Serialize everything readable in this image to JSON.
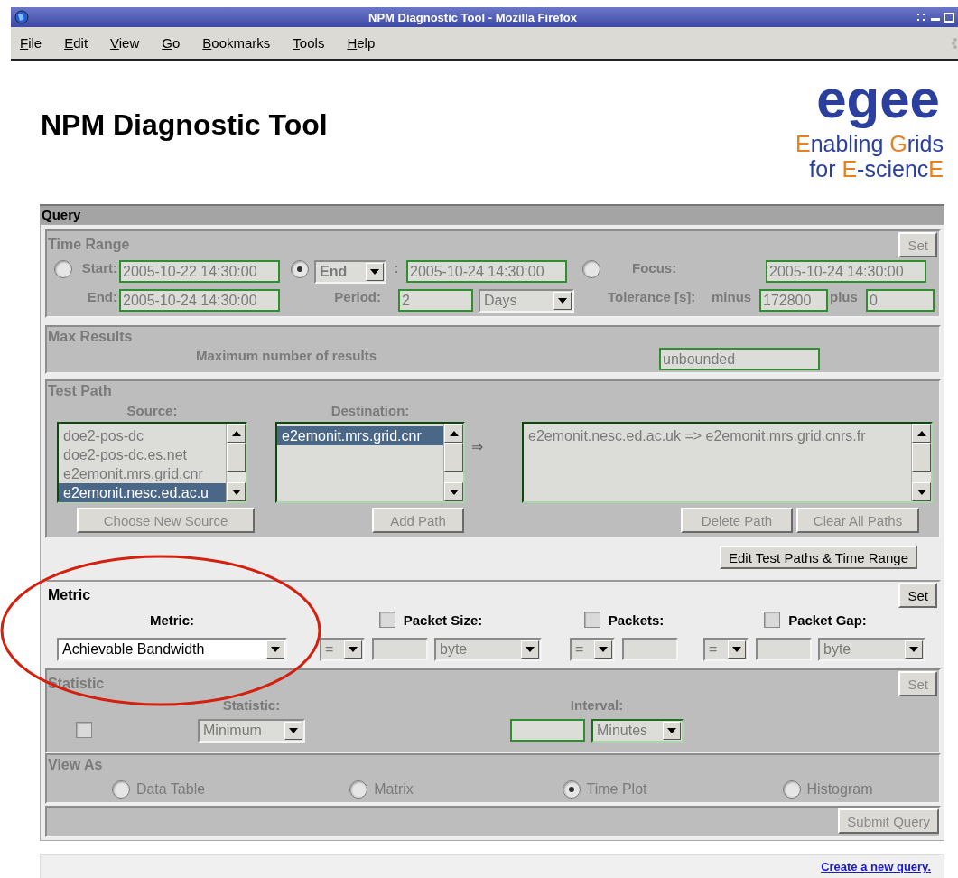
{
  "window": {
    "title": "NPM Diagnostic Tool - Mozilla Firefox"
  },
  "menu": [
    "File",
    "Edit",
    "View",
    "Go",
    "Bookmarks",
    "Tools",
    "Help"
  ],
  "heading": "NPM Diagnostic Tool",
  "logo": {
    "wordmark": "egee",
    "tagline": [
      "Enabling Grids",
      "for E-sciencE"
    ]
  },
  "query": {
    "title": "Query",
    "time_range": {
      "title": "Time Range",
      "disabled": true,
      "set_button": "Set",
      "start": {
        "selected": false,
        "label": "Start:",
        "value": "2005-10-22 14:30:00"
      },
      "end": {
        "label": "End:",
        "value": "2005-10-24 14:30:00"
      },
      "anchor": {
        "selected": true,
        "select": "End",
        "separator": ":",
        "value": "2005-10-24 14:30:00"
      },
      "period": {
        "label": "Period:",
        "value": "2",
        "unit": "Days"
      },
      "focus": {
        "selected": false,
        "label": "Focus:",
        "value": "2005-10-24 14:30:00"
      },
      "tolerance": {
        "label": "Tolerance [s]:",
        "minus_label": "minus",
        "minus_value": "172800",
        "plus_label": "plus",
        "plus_value": "0"
      }
    },
    "max_results": {
      "title": "Max Results",
      "disabled": true,
      "label": "Maximum number of results",
      "value": "unbounded"
    },
    "test_path": {
      "title": "Test Path",
      "disabled": true,
      "source_label": "Source:",
      "destination_label": "Destination:",
      "sources": [
        {
          "text": "doe2-pos-dc",
          "selected": false
        },
        {
          "text": "doe2-pos-dc.es.net",
          "selected": false
        },
        {
          "text": "e2emonit.mrs.grid.cnr",
          "selected": false
        },
        {
          "text": "e2emonit.nesc.ed.ac.u",
          "selected": true
        }
      ],
      "destinations": [
        {
          "text": "e2emonit.mrs.grid.cnr",
          "selected": true
        }
      ],
      "arrow": "⇒",
      "paths": [
        {
          "text": "e2emonit.nesc.ed.ac.uk => e2emonit.mrs.grid.cnrs.fr",
          "selected": false
        }
      ],
      "buttons": [
        "Choose New Source",
        "Add Path",
        "Delete Path",
        "Clear All Paths"
      ]
    },
    "edit_button": "Edit Test Paths & Time Range",
    "metric": {
      "title": "Metric",
      "disabled": false,
      "set_button": "Set",
      "label": "Metric:",
      "value": "Achievable Bandwidth",
      "filters": [
        {
          "label": "Packet Size:",
          "checked": false,
          "operator": "=",
          "unit": "byte"
        },
        {
          "label": "Packets:",
          "checked": false,
          "operator": "="
        },
        {
          "label": "Packet Gap:",
          "checked": false,
          "operator": "=",
          "unit": "byte"
        }
      ]
    },
    "statistic": {
      "title": "Statistic",
      "disabled": true,
      "set_button": "Set",
      "checked": false,
      "label": "Statistic:",
      "value": "Minimum",
      "interval_label": "Interval:",
      "interval_unit": "Minutes"
    },
    "view_as": {
      "title": "View As",
      "disabled": true,
      "options": [
        {
          "label": "Data Table",
          "selected": false
        },
        {
          "label": "Matrix",
          "selected": false
        },
        {
          "label": "Time Plot",
          "selected": true
        },
        {
          "label": "Histogram",
          "selected": false
        }
      ]
    },
    "submit_button": "Submit Query"
  },
  "footer": {
    "link": "Create a new query."
  },
  "annotations": [
    {
      "kind": "ellipse"
    }
  ]
}
